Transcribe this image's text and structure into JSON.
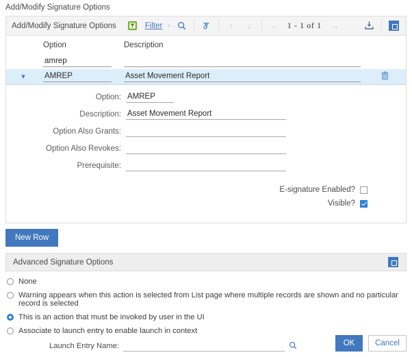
{
  "page": {
    "title": "Add/Modify Signature Options"
  },
  "section": {
    "title": "Add/Modify Signature Options",
    "filter_label": "Filter",
    "pager_text": "1 - 1 of 1",
    "icons": {
      "table_filter": "table-filter-icon",
      "chevron_right": "›",
      "search": "search-icon",
      "clear_filter": "clear-filter-icon",
      "sort_asc": "↑",
      "sort_desc": "↓",
      "prev": "←",
      "next": "→",
      "download": "download-icon",
      "maximize": "maximize-icon"
    }
  },
  "grid": {
    "columns": [
      "Option",
      "Description"
    ],
    "filter_row": {
      "option": "amrep",
      "description": ""
    },
    "rows": [
      {
        "option": "AMREP",
        "description": "Asset Movement Report",
        "expanded": true
      }
    ]
  },
  "detail": {
    "fields": [
      {
        "label": "Option:",
        "value": "AMREP"
      },
      {
        "label": "Description:",
        "value": "Asset Movement Report"
      },
      {
        "label": "Option Also Grants:",
        "value": ""
      },
      {
        "label": "Option Also Revokes:",
        "value": ""
      },
      {
        "label": "Prerequisite:",
        "value": ""
      }
    ],
    "checkboxes": [
      {
        "label": "E-signature Enabled?",
        "checked": false
      },
      {
        "label": "Visible?",
        "checked": true
      }
    ]
  },
  "actions": {
    "new_row": "New Row"
  },
  "advanced": {
    "title": "Advanced Signature Options",
    "options": [
      {
        "label": "None",
        "selected": false
      },
      {
        "label": "Warning appears when this action is selected from List page where multiple records are shown and no particular record is selected",
        "selected": false
      },
      {
        "label": "This is an action that must be invoked by user in the UI",
        "selected": true
      },
      {
        "label": "Associate to launch entry to enable launch in context",
        "selected": false
      }
    ],
    "launch_entry": {
      "label": "Launch Entry Name:",
      "value": ""
    }
  },
  "footer": {
    "ok": "OK",
    "cancel": "Cancel"
  }
}
